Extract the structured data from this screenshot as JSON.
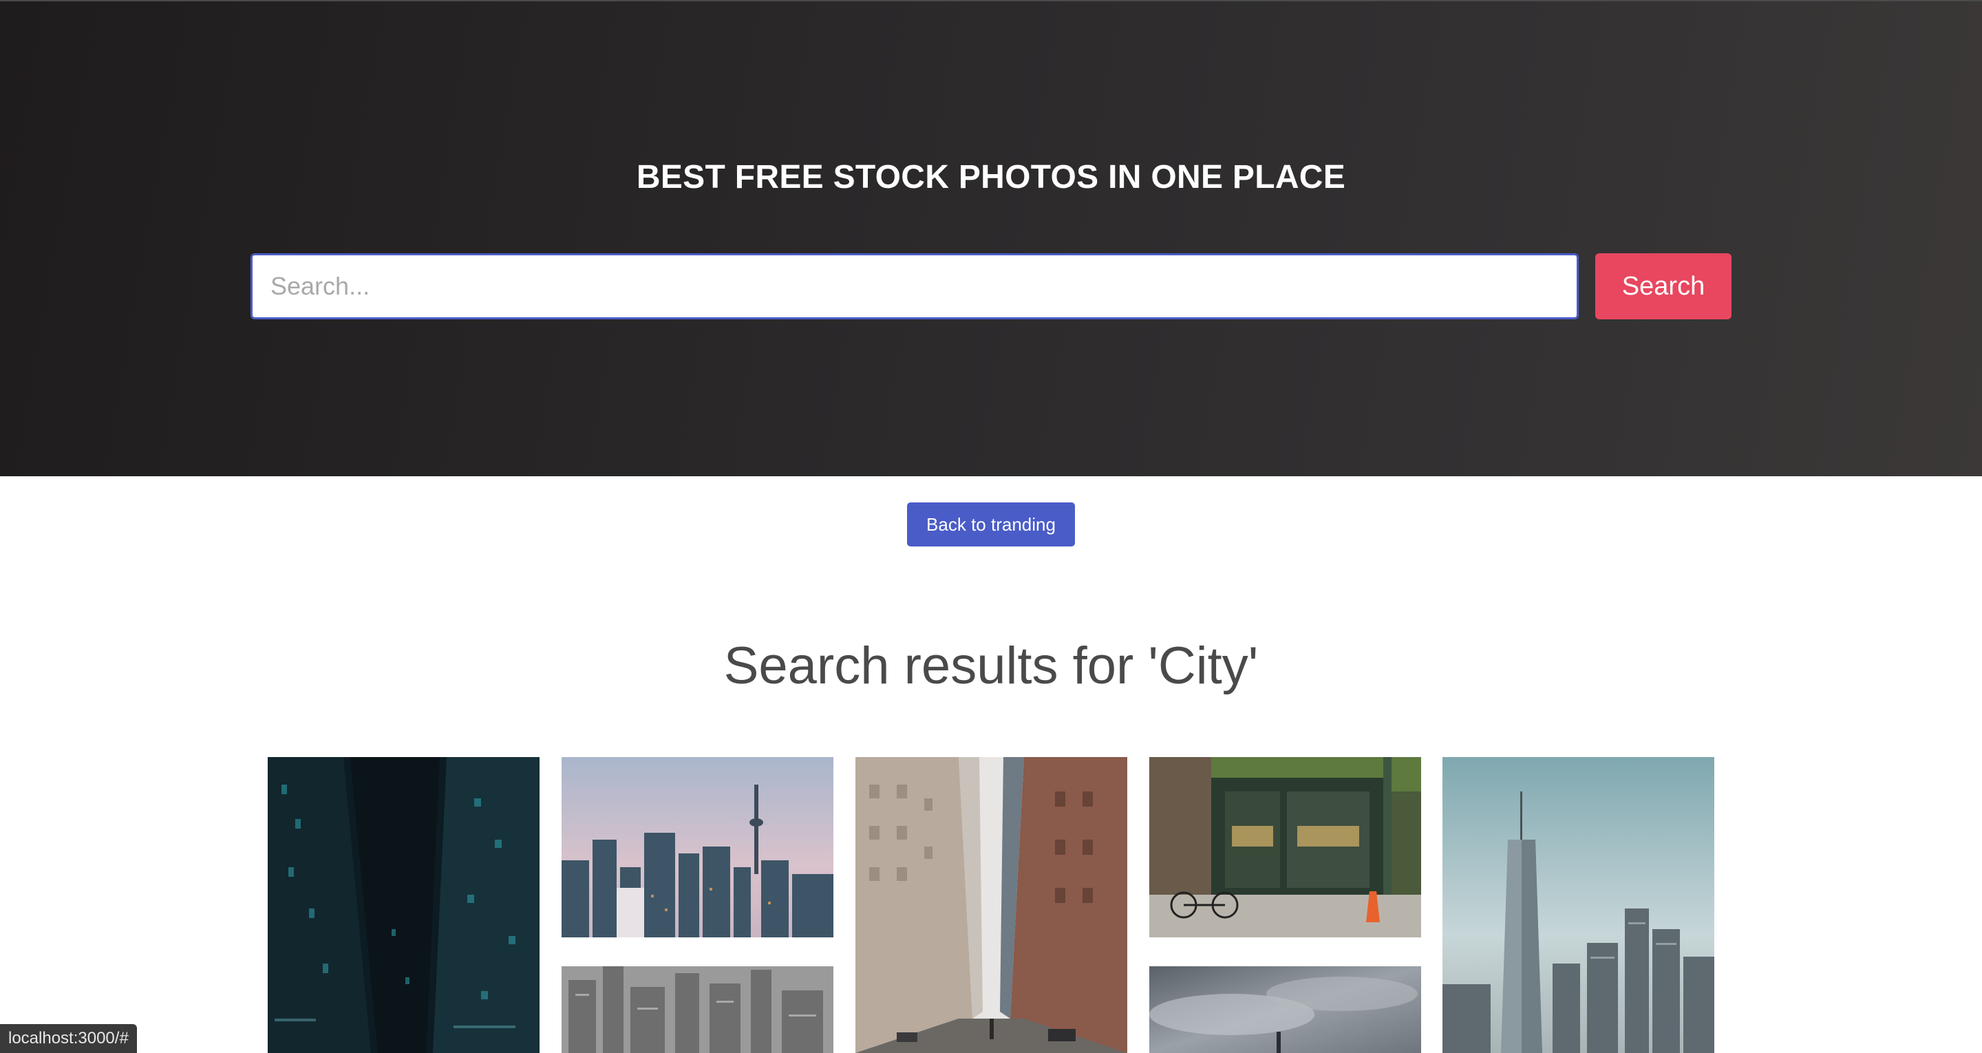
{
  "hero": {
    "title": "BEST FREE STOCK PHOTOS IN ONE PLACE",
    "search_placeholder": "Search...",
    "search_value": "",
    "search_button_label": "Search"
  },
  "back_button_label": "Back to tranding",
  "results_heading": "Search results for 'City'",
  "status_bar_url": "localhost:3000/#",
  "colors": {
    "accent_blue": "#4a5cc7",
    "accent_pink": "#e8475f",
    "hero_dark": "#2b292a"
  },
  "photos": [
    {
      "name": "photo-dark-skyscrapers",
      "subject": "dark teal skyscrapers at night"
    },
    {
      "name": "photo-toronto-skyline",
      "subject": "city skyline with tower at dusk"
    },
    {
      "name": "photo-street-buildings",
      "subject": "street between tall buildings"
    },
    {
      "name": "photo-bakery-storefront",
      "subject": "bakery storefront with bicycle"
    },
    {
      "name": "photo-one-world-trade",
      "subject": "tall tower over city skyline"
    },
    {
      "name": "photo-bw-city-aerial",
      "subject": "black and white city aerial"
    },
    {
      "name": "photo-cloudy-sky",
      "subject": "cloudy grey sky"
    }
  ]
}
